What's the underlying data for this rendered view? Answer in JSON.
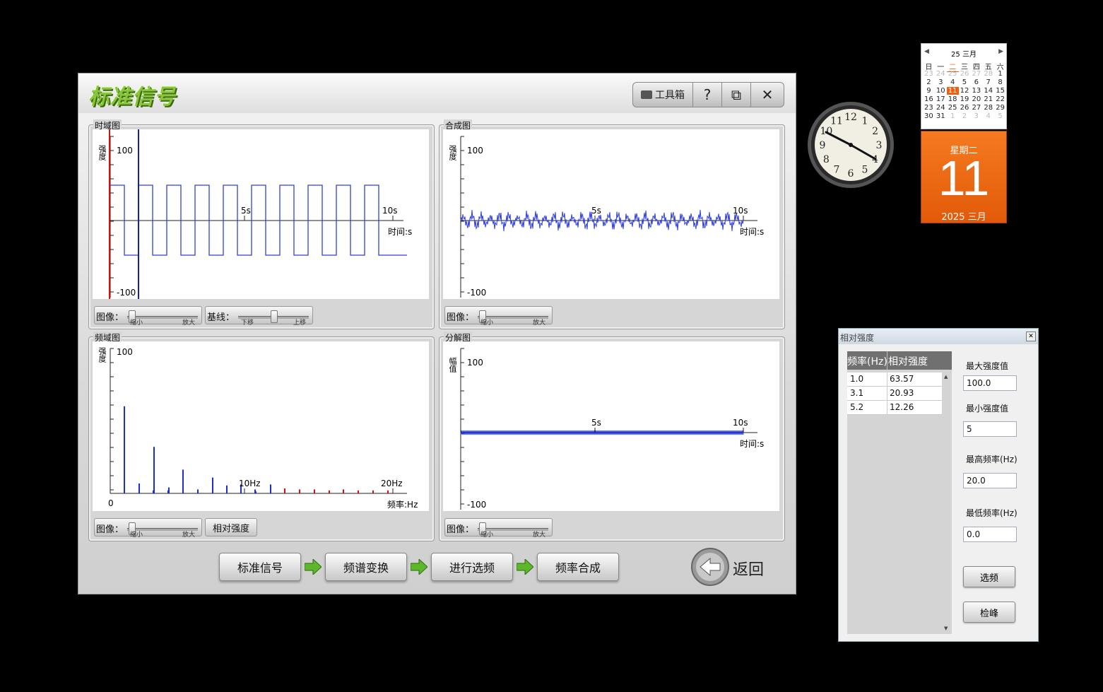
{
  "app": {
    "title": "标准信号",
    "toolbox_label": "工具箱",
    "help_label": "?",
    "restore_label": "⧉",
    "close_label": "✕"
  },
  "panels": {
    "time_domain": {
      "title": "时域图",
      "y_axis_label": "强度",
      "y_max": "100",
      "y_min": "-100",
      "x_tick_5": "5s",
      "x_tick_10": "10s",
      "x_axis_label": "时间:s",
      "controls": {
        "image_label": "图像：",
        "zoom_min": "缩小",
        "zoom_max": "放大",
        "baseline_label": "基线：",
        "baseline_min": "下移",
        "baseline_max": "上移"
      }
    },
    "composite": {
      "title": "合成图",
      "y_axis_label": "强度",
      "y_max": "100",
      "y_min": "-100",
      "x_tick_5": "5s",
      "x_tick_10": "10s",
      "x_axis_label": "时间:s",
      "controls": {
        "image_label": "图像：",
        "zoom_min": "缩小",
        "zoom_max": "放大"
      }
    },
    "frequency_domain": {
      "title": "频域图",
      "y_axis_label": "强度",
      "y_max": "100",
      "x_origin": "0",
      "x_tick_10": "10Hz",
      "x_tick_20": "20Hz",
      "x_axis_label": "频率:Hz",
      "controls": {
        "image_label": "图像：",
        "zoom_min": "缩小",
        "zoom_max": "放大",
        "relative_intensity_button": "相对强度"
      }
    },
    "decomposition": {
      "title": "分解图",
      "y_axis_label": "幅值",
      "y_max": "100",
      "y_min": "-100",
      "x_tick_5": "5s",
      "x_tick_10": "10s",
      "x_axis_label": "时间:s",
      "controls": {
        "image_label": "图像：",
        "zoom_min": "缩小",
        "zoom_max": "放大"
      }
    }
  },
  "workflow": {
    "steps": [
      "标准信号",
      "频谱变换",
      "进行选频",
      "频率合成"
    ],
    "back_label": "返回"
  },
  "relative_intensity_dialog": {
    "title": "相对强度",
    "columns": [
      "频率(Hz)",
      "相对强度"
    ],
    "rows": [
      {
        "freq": "1.0",
        "intensity": "63.57"
      },
      {
        "freq": "3.1",
        "intensity": "20.93"
      },
      {
        "freq": "5.2",
        "intensity": "12.26"
      }
    ],
    "max_intensity_label": "最大强度值",
    "max_intensity_value": "100.0",
    "min_intensity_label": "最小强度值",
    "min_intensity_value": "5",
    "max_freq_label": "最高频率(Hz)",
    "max_freq_value": "20.0",
    "min_freq_label": "最低频率(Hz)",
    "min_freq_value": "0.0",
    "select_button": "选频",
    "peak_button": "检峰"
  },
  "calendar": {
    "header": "25 三月",
    "weekdays": [
      "日",
      "一",
      "二",
      "三",
      "四",
      "五",
      "六"
    ],
    "weeks": [
      [
        "23",
        "24",
        "25",
        "26",
        "27",
        "28",
        "1"
      ],
      [
        "2",
        "3",
        "4",
        "5",
        "6",
        "7",
        "8"
      ],
      [
        "9",
        "10",
        "11",
        "12",
        "13",
        "14",
        "15"
      ],
      [
        "16",
        "17",
        "18",
        "19",
        "20",
        "21",
        "22"
      ],
      [
        "23",
        "24",
        "25",
        "26",
        "27",
        "28",
        "29"
      ],
      [
        "30",
        "31",
        "1",
        "2",
        "3",
        "4",
        "5"
      ]
    ],
    "weekday_label": "星期二",
    "day": "11",
    "month_year": "2025 三月"
  },
  "clock": {
    "numerals": [
      "12",
      "1",
      "2",
      "3",
      "4",
      "5",
      "6",
      "7",
      "8",
      "9",
      "10",
      "11"
    ]
  },
  "colors": {
    "signal_blue": "#2f3fe0",
    "cursor_red": "#d01010",
    "cursor_blue": "#1020b0",
    "calendar_orange": "#f06010"
  }
}
